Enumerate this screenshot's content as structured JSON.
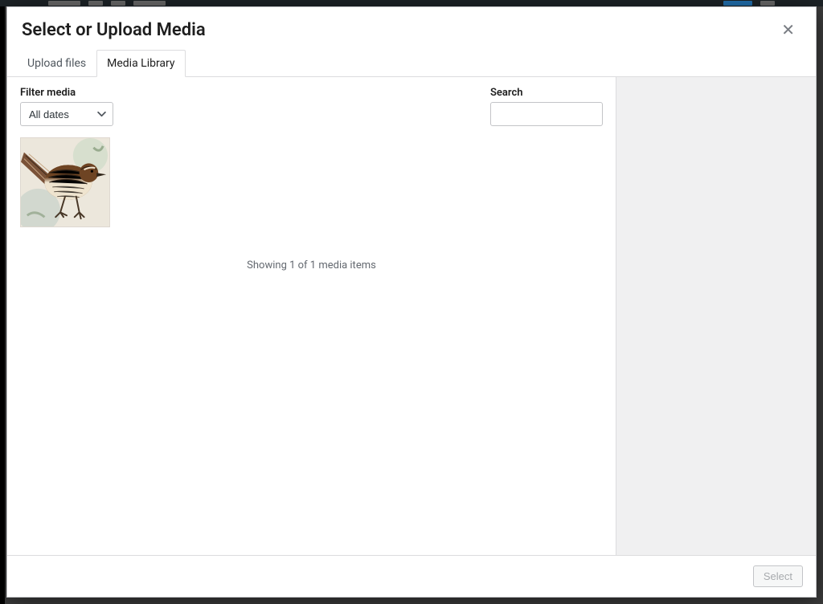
{
  "modal": {
    "title": "Select or Upload Media",
    "close_glyph": "✕"
  },
  "tabs": {
    "upload": "Upload files",
    "library": "Media Library"
  },
  "filter": {
    "label": "Filter media",
    "selected": "All dates"
  },
  "search": {
    "label": "Search",
    "value": ""
  },
  "status": "Showing 1 of 1 media items",
  "footer": {
    "select_label": "Select"
  }
}
